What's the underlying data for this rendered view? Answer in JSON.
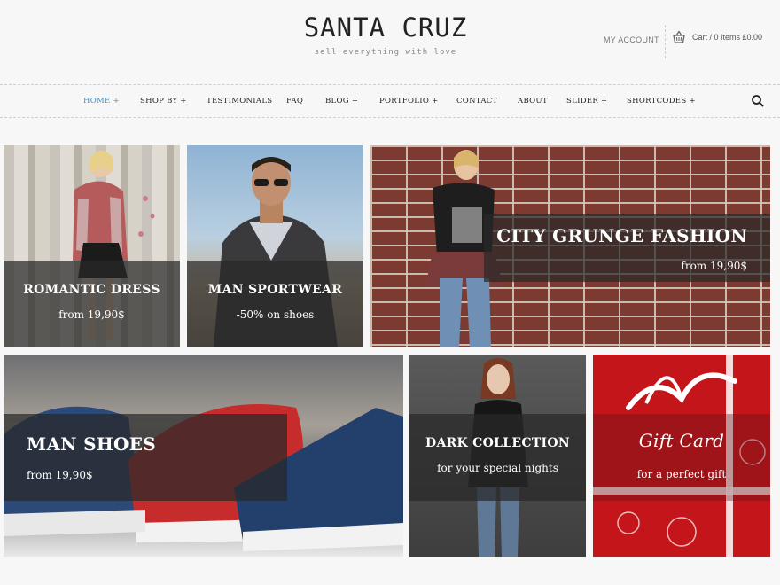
{
  "header": {
    "logo_title": "SANTA CRUZ",
    "logo_tagline": "sell everything with love",
    "my_account": "MY ACCOUNT",
    "cart_text": "Cart / 0 Items £0.00",
    "cart_icon": "basket-icon"
  },
  "nav": {
    "items": [
      {
        "label": "HOME +",
        "active": true
      },
      {
        "label": "SHOP BY +"
      },
      {
        "label": "TESTIMONIALS"
      },
      {
        "label": "FAQ"
      },
      {
        "label": "BLOG +"
      },
      {
        "label": "PORTFOLIO +"
      },
      {
        "label": "CONTACT"
      },
      {
        "label": "ABOUT"
      },
      {
        "label": "SLIDER +"
      },
      {
        "label": "SHORTCODES +"
      }
    ],
    "search_icon": "search-icon",
    "active_color": "#4a8fbd"
  },
  "tiles": [
    {
      "title": "ROMANTIC DRESS",
      "subtitle": "from 19,90$"
    },
    {
      "title": "MAN SPORTWEAR",
      "subtitle": "-50% on shoes"
    },
    {
      "title": "CITY GRUNGE FASHION",
      "subtitle": "from 19,90$"
    },
    {
      "title": "MAN SHOES",
      "subtitle": "from 19,90$"
    },
    {
      "title": "DARK COLLECTION",
      "subtitle": "for your special nights"
    },
    {
      "title": "Gift Card",
      "subtitle": "for a perfect gift"
    }
  ],
  "colors": {
    "background": "#f7f7f7",
    "overlay": "#282828",
    "gift_red": "#c4151b"
  }
}
